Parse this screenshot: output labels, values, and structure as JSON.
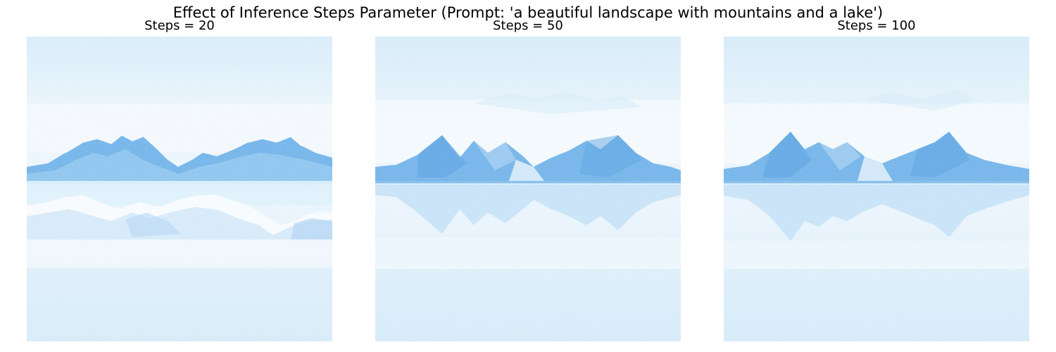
{
  "figure": {
    "title": "Effect of Inference Steps Parameter (Prompt: 'a beautiful landscape with mountains and a lake')"
  },
  "panels": [
    {
      "label": "Steps = 20",
      "steps": 20
    },
    {
      "label": "Steps = 50",
      "steps": 50
    },
    {
      "label": "Steps = 100",
      "steps": 100
    }
  ],
  "colors": {
    "background": "#cfe8f7",
    "haze": "#eef6fc",
    "mountain_dark": "#4a9ee0",
    "mountain_mid": "#7fbdec",
    "mountain_light": "#b4d9f5",
    "snow": "#f4f9fe"
  }
}
